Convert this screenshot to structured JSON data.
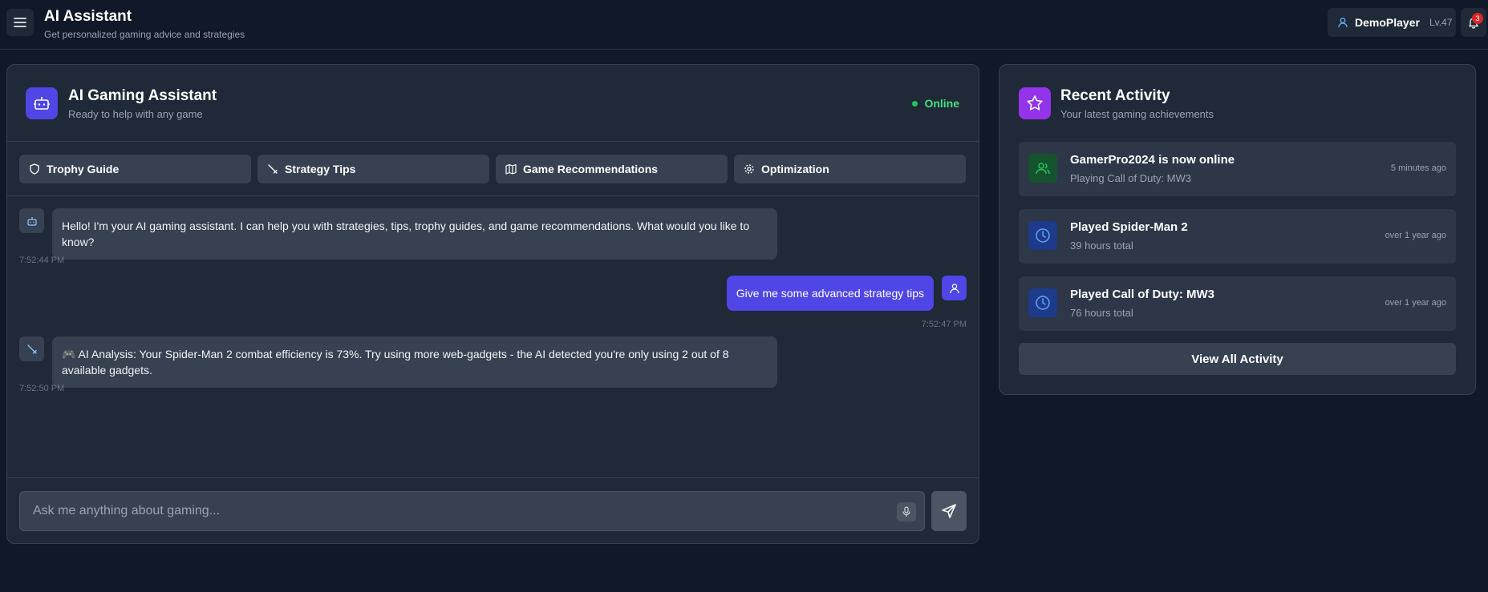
{
  "header": {
    "title": "AI Assistant",
    "subtitle": "Get personalized gaming advice and strategies",
    "user": {
      "name": "DemoPlayer",
      "level": "Lv.47"
    },
    "notifications_count": "3"
  },
  "chat": {
    "title": "AI Gaming Assistant",
    "subtitle": "Ready to help with any game",
    "status": "Online",
    "quick_actions": [
      {
        "label": "Trophy Guide",
        "icon": "shield-icon"
      },
      {
        "label": "Strategy Tips",
        "icon": "sword-icon"
      },
      {
        "label": "Game Recommendations",
        "icon": "map-icon"
      },
      {
        "label": "Optimization",
        "icon": "gear-icon"
      }
    ],
    "messages": [
      {
        "sender": "assistant",
        "icon": "bot-icon",
        "text": "Hello! I'm your AI gaming assistant. I can help you with strategies, tips, trophy guides, and game recommendations. What would you like to know?",
        "time": "7:52:44 PM"
      },
      {
        "sender": "user",
        "icon": "user-icon",
        "text": "Give me some advanced strategy tips",
        "time": "7:52:47 PM"
      },
      {
        "sender": "assistant",
        "icon": "sword-icon",
        "text": "🎮 AI Analysis: Your Spider-Man 2 combat efficiency is 73%. Try using more web-gadgets - the AI detected you're only using 2 out of 8 available gadgets.",
        "time": "7:52:50 PM"
      }
    ],
    "input_placeholder": "Ask me anything about gaming..."
  },
  "activity": {
    "title": "Recent Activity",
    "subtitle": "Your latest gaming achievements",
    "items": [
      {
        "name": "GamerPro2024 is now online",
        "detail": "Playing Call of Duty: MW3",
        "time": "5 minutes ago",
        "icon": "users-icon",
        "color": "#22c55e"
      },
      {
        "name": "Played Spider-Man 2",
        "detail": "39 hours total",
        "time": "over 1 year ago",
        "icon": "clock-icon",
        "color": "#60a5fa"
      },
      {
        "name": "Played Call of Duty: MW3",
        "detail": "76 hours total",
        "time": "over 1 year ago",
        "icon": "clock-icon",
        "color": "#60a5fa"
      }
    ],
    "view_all_label": "View All Activity"
  },
  "colors": {
    "background": "#111827",
    "panel": "#1f2937",
    "accent": "#4f46e5",
    "purple": "#9333ea",
    "online": "#22c55e",
    "badge": "#dc2626"
  }
}
